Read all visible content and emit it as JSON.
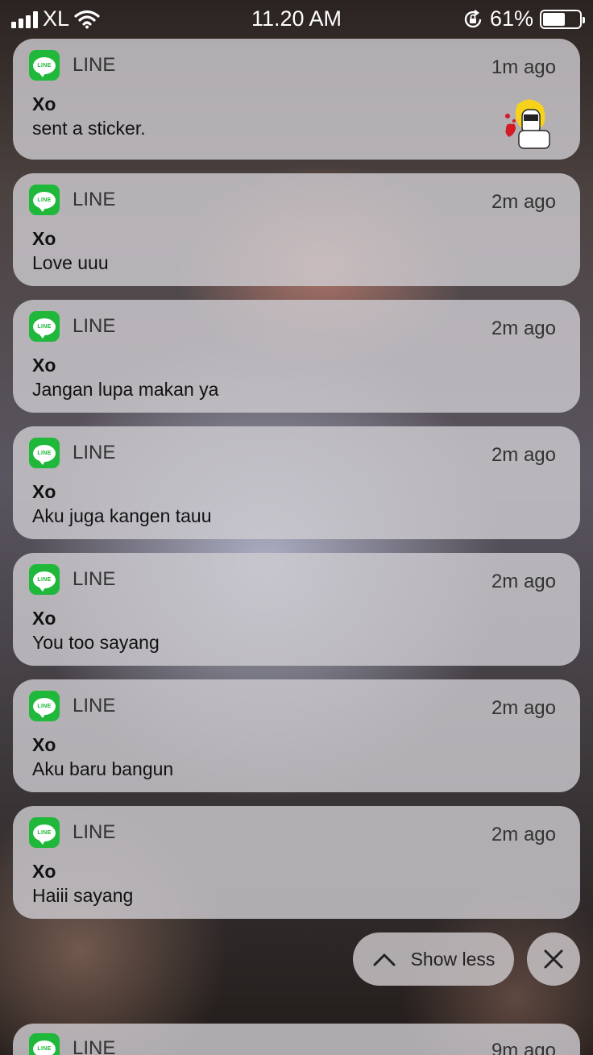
{
  "status_bar": {
    "carrier": "XL",
    "time": "11.20 AM",
    "battery_percent": "61%",
    "battery_level": 0.61,
    "icons": [
      "signal-icon",
      "wifi-icon",
      "rotation-lock-icon",
      "battery-icon"
    ]
  },
  "notifications": [
    {
      "app": "LINE",
      "icon_label": "LINE",
      "time": "1m ago",
      "sender": "Xo",
      "message": "sent a sticker.",
      "has_sticker": true
    },
    {
      "app": "LINE",
      "icon_label": "LINE",
      "time": "2m ago",
      "sender": "Xo",
      "message": "Love uuu"
    },
    {
      "app": "LINE",
      "icon_label": "LINE",
      "time": "2m ago",
      "sender": "Xo",
      "message": "Jangan lupa makan ya"
    },
    {
      "app": "LINE",
      "icon_label": "LINE",
      "time": "2m ago",
      "sender": "Xo",
      "message": "Aku juga kangen tauu"
    },
    {
      "app": "LINE",
      "icon_label": "LINE",
      "time": "2m ago",
      "sender": "Xo",
      "message": "You too sayang"
    },
    {
      "app": "LINE",
      "icon_label": "LINE",
      "time": "2m ago",
      "sender": "Xo",
      "message": "Aku baru bangun"
    },
    {
      "app": "LINE",
      "icon_label": "LINE",
      "time": "2m ago",
      "sender": "Xo",
      "message": "Haiii sayang"
    }
  ],
  "controls": {
    "show_less_label": "Show less",
    "close_icon": "close-icon"
  },
  "partial_notification": {
    "app": "LINE",
    "icon_label": "LINE",
    "time": "9m ago"
  },
  "colors": {
    "line_green": "#1fb83a",
    "card_bg": "#cdcbd0"
  }
}
